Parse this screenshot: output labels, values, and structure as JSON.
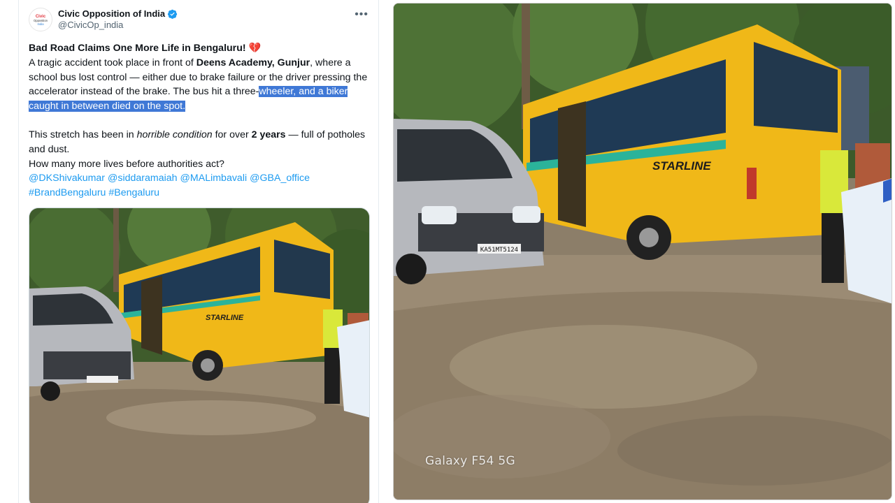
{
  "author": {
    "display_name": "Civic Opposition of India",
    "handle": "@CivicOp_india",
    "verified_icon": "verified-badge-icon",
    "avatar_label": "Civic Opposition"
  },
  "tweet": {
    "headline": "Bad Road Claims One More Life in Bengaluru!",
    "headline_emoji": "💔",
    "para1_a": "A tragic accident took place in front of ",
    "para1_bold": "Deens Academy, Gunjur",
    "para1_b": ", where a school bus lost control — either due to brake failure or the driver pressing the accelerator instead of the brake. The bus hit a three-",
    "para1_highlight": "wheeler, and a biker caught in between died on the spot.",
    "para2_a": "This stretch has been in ",
    "para2_italic": "horrible condition",
    "para2_b": " for over ",
    "para2_bold": "2 years",
    "para2_c": " — full of potholes and dust.",
    "para3": "How many more lives before authorities act?",
    "mentions": [
      "@DKShivakumar",
      "@siddaramaiah",
      "@MALimbavali",
      "@GBA_office"
    ],
    "hashtags": [
      "#BrandBengaluru",
      "#Bengaluru"
    ]
  },
  "photo": {
    "bus_brand": "STARLINE",
    "plate": "KA51MT5124",
    "watermark": "Galaxy F54 5G"
  },
  "colors": {
    "link": "#1d9bf0",
    "highlight": "#3f78d6",
    "bus_yellow": "#f0b818",
    "bus_stripe": "#2bb39a",
    "verified": "#1d9bf0"
  }
}
